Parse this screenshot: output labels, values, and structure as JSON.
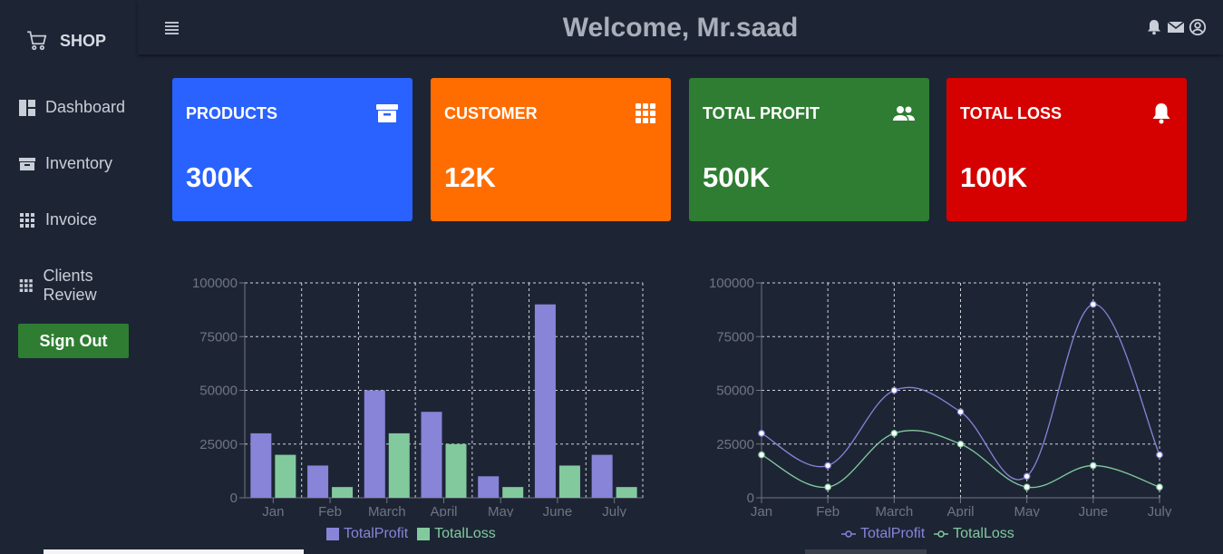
{
  "sidebar": {
    "brand": "SHOP",
    "items": [
      {
        "label": "Dashboard",
        "icon": "dashboard-icon"
      },
      {
        "label": "Inventory",
        "icon": "archive-icon"
      },
      {
        "label": "Invoice",
        "icon": "grid-icon"
      },
      {
        "label": "Clients Review",
        "icon": "grid-icon"
      }
    ],
    "signout_label": "Sign Out"
  },
  "header": {
    "welcome": "Welcome, Mr.saad",
    "icons": [
      "bell-icon",
      "mail-icon",
      "user-circle-icon"
    ]
  },
  "cards": [
    {
      "label": "PRODUCTS",
      "value": "300K",
      "color": "#2962ff",
      "icon": "archive-icon"
    },
    {
      "label": "CUSTOMER",
      "value": "12K",
      "color": "#ff6d00",
      "icon": "apps-icon"
    },
    {
      "label": "TOTAL PROFIT",
      "value": "500K",
      "color": "#2e7d32",
      "icon": "people-icon"
    },
    {
      "label": "TOTAL LOSS",
      "value": "100K",
      "color": "#d50000",
      "icon": "bell-icon"
    }
  ],
  "colors": {
    "profit": "#8884d8",
    "loss": "#82ca9d",
    "grid": "#cfd3da",
    "axis_text": "#6f7480"
  },
  "chart_data": [
    {
      "type": "bar",
      "categories": [
        "Jan",
        "Feb",
        "March",
        "April",
        "May",
        "June",
        "July"
      ],
      "series": [
        {
          "name": "TotalProfit",
          "values": [
            30000,
            15000,
            50000,
            40000,
            10000,
            90000,
            20000
          ]
        },
        {
          "name": "TotalLoss",
          "values": [
            20000,
            5000,
            30000,
            25000,
            5000,
            15000,
            5000
          ]
        }
      ],
      "yticks": [
        "0",
        "25000",
        "50000",
        "75000",
        "100000"
      ],
      "ylim": [
        0,
        100000
      ],
      "grid": true,
      "legend": "bottom"
    },
    {
      "type": "line",
      "categories": [
        "Jan",
        "Feb",
        "March",
        "April",
        "May",
        "June",
        "July"
      ],
      "series": [
        {
          "name": "TotalProfit",
          "values": [
            30000,
            15000,
            50000,
            40000,
            10000,
            90000,
            20000
          ]
        },
        {
          "name": "TotalLoss",
          "values": [
            20000,
            5000,
            30000,
            25000,
            5000,
            15000,
            5000
          ]
        }
      ],
      "yticks": [
        "0",
        "25000",
        "50000",
        "75000",
        "100000"
      ],
      "ylim": [
        0,
        100000
      ],
      "grid": true,
      "legend": "bottom"
    }
  ]
}
